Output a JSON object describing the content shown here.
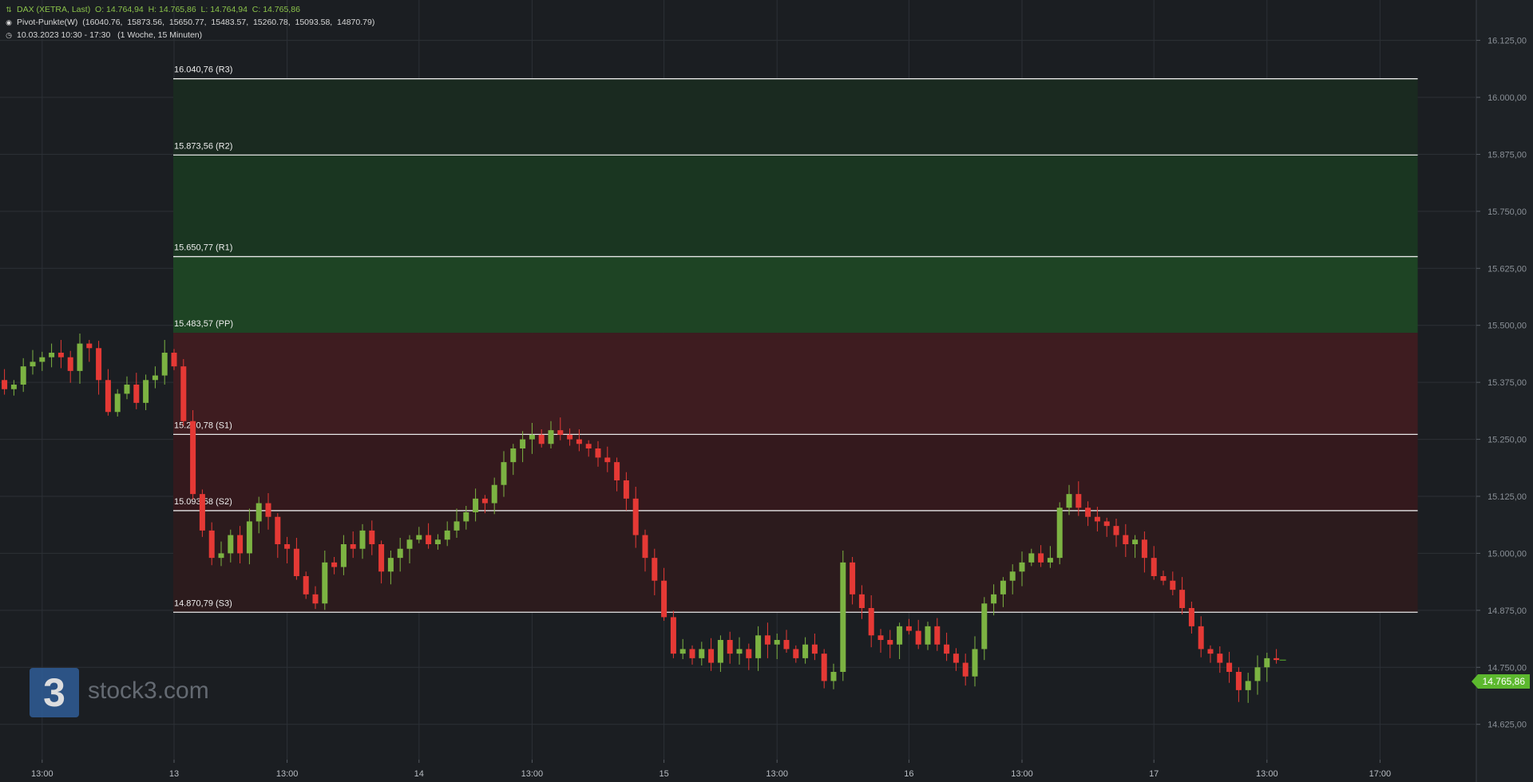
{
  "header": {
    "instrument": "DAX (XETRA, Last)",
    "ohlc": "O: 14.764,94  H: 14.765,86  L: 14.764,94  C: 14.765,86",
    "indicator": "Pivot-Punkte(W)  (16040.76,  15873.56,  15650.77,  15483.57,  15260.78,  15093.58,  14870.79)",
    "range": "10.03.2023 10:30 - 17:30   (1 Woche, 15 Minuten)"
  },
  "icons": {
    "instrument": "candlestick-icon",
    "indicator": "target-icon",
    "range": "clock-icon"
  },
  "logo": {
    "mark": "3",
    "text": "stock3.com"
  },
  "colors": {
    "up": "#7cb342",
    "down": "#e53935",
    "resistance_zone": "#1f5a24",
    "support_zone": "#5a1c20",
    "last_price": "#5cb82e"
  },
  "chart_data": {
    "type": "candlestick",
    "title": "",
    "xlabel": "",
    "ylabel": "",
    "ylim": [
      14600,
      16175
    ],
    "y_ticks": [
      "14.625,00",
      "14.750,00",
      "14.875,00",
      "15.000,00",
      "15.125,00",
      "15.250,00",
      "15.375,00",
      "15.500,00",
      "15.625,00",
      "15.750,00",
      "15.875,00",
      "16.000,00",
      "16.125,00"
    ],
    "y_tick_values": [
      14625,
      14750,
      14875,
      15000,
      15125,
      15250,
      15375,
      15500,
      15625,
      15750,
      15875,
      16000,
      16125
    ],
    "x_ticks": [
      "13:00",
      "13",
      "13:00",
      "14",
      "13:00",
      "15",
      "13:00",
      "16",
      "13:00",
      "17",
      "13:00",
      "17:00"
    ],
    "x_tick_bars": [
      -14,
      0,
      12,
      26,
      38,
      52,
      64,
      78,
      90,
      104,
      116,
      128
    ],
    "pivot_start_bar": 0,
    "pivot_end_bar": 132,
    "pivots": [
      {
        "label": "16.040,76 (R3)",
        "value": 16040.76
      },
      {
        "label": "15.873,56 (R2)",
        "value": 15873.56
      },
      {
        "label": "15.650,77 (R1)",
        "value": 15650.77
      },
      {
        "label": "15.483,57 (PP)",
        "value": 15483.57
      },
      {
        "label": "15.260,78 (S1)",
        "value": 15260.78
      },
      {
        "label": "15.093,58 (S2)",
        "value": 15093.58
      },
      {
        "label": "14.870,79 (S3)",
        "value": 14870.79
      }
    ],
    "last_price": 14765.86,
    "last_price_label": "14.765,86",
    "prev_week_closes": [
      15400,
      15380,
      15360,
      15370,
      15410,
      15420,
      15430,
      15440,
      15430,
      15400,
      15460,
      15450,
      15380,
      15310,
      15350,
      15370,
      15330,
      15380,
      15390,
      15440
    ],
    "closes": [
      15410,
      15290,
      15130,
      15050,
      14990,
      15000,
      15040,
      15000,
      15070,
      15110,
      15080,
      15020,
      15010,
      14950,
      14910,
      14890,
      14980,
      14970,
      15020,
      15010,
      15050,
      15020,
      14960,
      14990,
      15010,
      15030,
      15040,
      15020,
      15030,
      15050,
      15070,
      15090,
      15120,
      15110,
      15150,
      15200,
      15230,
      15250,
      15260,
      15240,
      15270,
      15260,
      15250,
      15240,
      15230,
      15210,
      15200,
      15160,
      15120,
      15040,
      14990,
      14940,
      14860,
      14780,
      14790,
      14770,
      14790,
      14760,
      14810,
      14780,
      14790,
      14770,
      14820,
      14800,
      14810,
      14790,
      14770,
      14800,
      14780,
      14720,
      14740,
      14980,
      14910,
      14880,
      14820,
      14810,
      14800,
      14840,
      14830,
      14800,
      14840,
      14800,
      14780,
      14760,
      14730,
      14790,
      14890,
      14910,
      14940,
      14960,
      14980,
      15000,
      14980,
      14990,
      15100,
      15130,
      15100,
      15080,
      15070,
      15060,
      15040,
      15020,
      15030,
      14990,
      14950,
      14940,
      14920,
      14880,
      14840,
      14790,
      14780,
      14760,
      14740,
      14700,
      14720,
      14750,
      14770,
      14766
    ]
  }
}
